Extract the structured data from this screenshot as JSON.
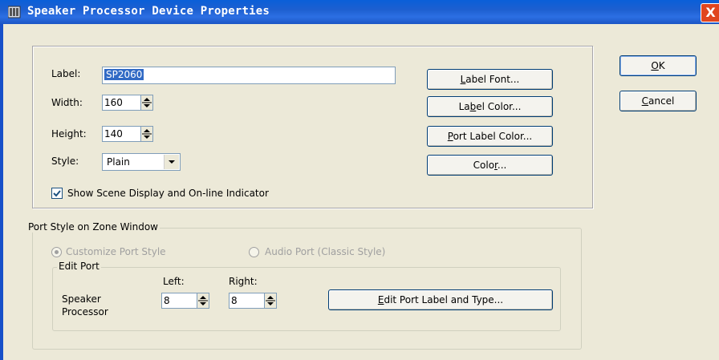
{
  "window": {
    "title": "Speaker Processor Device Properties",
    "close_glyph": "X",
    "accent": "#0a5fd8",
    "title_icon": "speaker-processor-app-icon"
  },
  "properties": {
    "label_caption": "Label:",
    "label_value": "SP2060",
    "width_caption": "Width:",
    "width_value": "160",
    "height_caption": "Height:",
    "height_value": "140",
    "style_caption": "Style:",
    "style_value": "Plain",
    "show_scene_checked": true,
    "show_scene_label": "Show Scene Display and On-line Indicator"
  },
  "buttons": {
    "label_font_pre": "",
    "label_font_u": "L",
    "label_font_post": "abel Font...",
    "label_color_pre": "La",
    "label_color_u": "b",
    "label_color_post": "el Color...",
    "port_label_color_pre": "",
    "port_label_color_u": "P",
    "port_label_color_post": "ort Label Color...",
    "color_pre": "Colo",
    "color_u": "r",
    "color_post": "...",
    "ok_u": "O",
    "ok_post": "K",
    "cancel_u": "C",
    "cancel_post": "ancel"
  },
  "port_style": {
    "group_title": "Port Style on Zone Window",
    "radio_customize": "Customize Port Style",
    "radio_audio": "Audio Port (Classic Style)",
    "selected": "Customize Port Style",
    "edit_port_title": "Edit Port",
    "left_caption": "Left:",
    "right_caption": "Right:",
    "row_label_line1": "Speaker",
    "row_label_line2": "Processor",
    "left_value": "8",
    "right_value": "8",
    "edit_button_pre": "",
    "edit_button_u": "E",
    "edit_button_post": "dit Port Label and Type..."
  }
}
